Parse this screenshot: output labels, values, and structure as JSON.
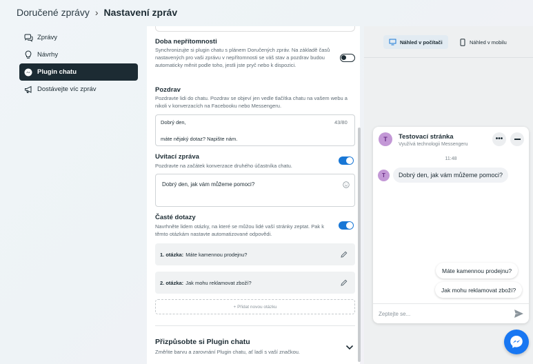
{
  "breadcrumb": {
    "root": "Doručené zprávy",
    "current": "Nastavení zpráv"
  },
  "sidebar": {
    "items": [
      {
        "label": "Zprávy",
        "icon": "chat-bubbles-icon"
      },
      {
        "label": "Návrhy",
        "icon": "lightbulb-icon"
      },
      {
        "label": "Plugin chatu",
        "icon": "messenger-icon",
        "active": true
      },
      {
        "label": "Dostávejte víc zpráv",
        "icon": "megaphone-icon"
      }
    ]
  },
  "settings": {
    "away": {
      "title": "Doba nepřítomnosti",
      "desc": "Synchronizujte si plugin chatu s plánem Doručených zpráv. Na základě časů nastavených pro vaši zprávu v nepřítomnosti se váš stav a pozdrav budou automaticky měnit podle toho, jestli jste pryč nebo k dispozici.",
      "enabled": false
    },
    "greeting": {
      "title": "Pozdrav",
      "desc": "Pozdravte lidi do chatu. Pozdrav se objeví jen vedle tlačítka chatu na vašem webu a nikoli v konverzacích na Facebooku nebo Messengeru.",
      "line1": "Dobrý den,",
      "line2": "máte nějaký dotaz? Napište nám.",
      "counter": "43/80"
    },
    "welcome": {
      "title": "Uvítací zpráva",
      "desc": "Pozdravte na začátek konverzace druhého účastníka chatu.",
      "text": "Dobrý den, jak vám můžeme pomoci?",
      "enabled": true
    },
    "faq": {
      "title": "Časté dotazy",
      "desc": "Navrhněte lidem otázky, na které se můžou lidé vaší stránky zeptat. Pak k těmto otázkám nastavte automatizované odpovědi.",
      "enabled": true,
      "questions": [
        {
          "prefix": "1. otázka:",
          "text": "Máte kamennou prodejnu?"
        },
        {
          "prefix": "2. otázka:",
          "text": "Jak mohu reklamovat zboží?"
        }
      ],
      "add_label": "+ Přidat novou otázku"
    },
    "customize": {
      "title": "Přizpůsobte si Plugin chatu",
      "desc": "Změňte barvu a zarovnání Plugin chatu, ať ladí s vaší značkou."
    }
  },
  "preview": {
    "tabs": [
      {
        "label": "Náhled v počítači",
        "active": true
      },
      {
        "label": "Náhled v mobilu"
      }
    ],
    "page_name": "Testovací stránka",
    "page_initial": "T",
    "powered_by": "Využívá technologii Messengeru",
    "time": "11:48",
    "message": "Dobrý den, jak vám můžeme pomoci?",
    "quick_replies": [
      "Máte kamennou prodejnu?",
      "Jak mohu reklamovat zboží?"
    ],
    "composer_placeholder": "Zeptejte se..."
  },
  "colors": {
    "accent": "#1877d6",
    "dark": "#1c2b33",
    "avatar": "#c398d6"
  }
}
